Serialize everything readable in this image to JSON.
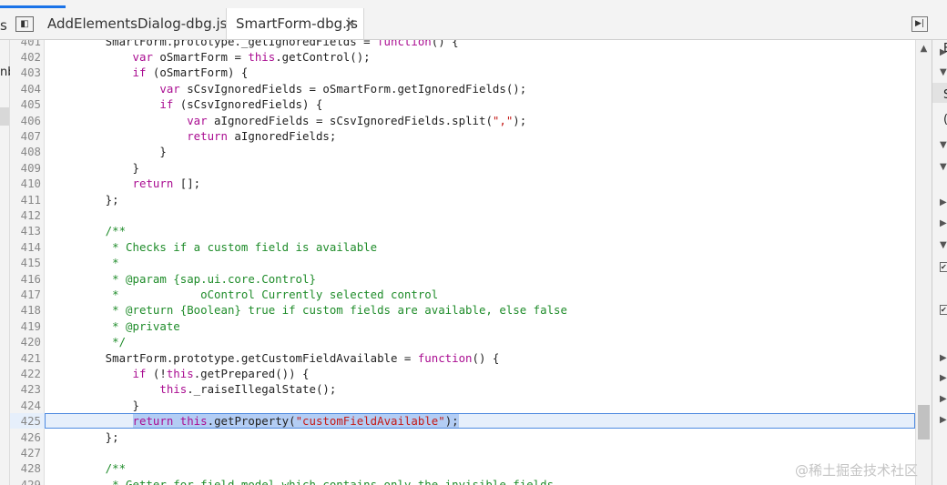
{
  "tabs": {
    "left_fragment": "s",
    "nav_toggle": "◧",
    "tab1": "AddElementsDialog-dbg.js",
    "tab2": "SmartForm-dbg.js",
    "close": "×",
    "right_toggle": "▶|"
  },
  "left_panel": {
    "fragment": "nb"
  },
  "editor": {
    "lines": [
      {
        "n": "401",
        "spans": [
          [
            "",
            "        SmartForm.prototype._getIgnoredFields = "
          ],
          [
            "kw",
            "function"
          ],
          [
            "",
            "() {"
          ]
        ]
      },
      {
        "n": "402",
        "spans": [
          [
            "",
            "            "
          ],
          [
            "kw",
            "var"
          ],
          [
            "",
            " oSmartForm = "
          ],
          [
            "kw",
            "this"
          ],
          [
            "",
            ".getControl();"
          ]
        ]
      },
      {
        "n": "403",
        "spans": [
          [
            "",
            "            "
          ],
          [
            "kw",
            "if"
          ],
          [
            "",
            " (oSmartForm) {"
          ]
        ]
      },
      {
        "n": "404",
        "spans": [
          [
            "",
            "                "
          ],
          [
            "kw",
            "var"
          ],
          [
            "",
            " sCsvIgnoredFields = oSmartForm.getIgnoredFields();"
          ]
        ]
      },
      {
        "n": "405",
        "spans": [
          [
            "",
            "                "
          ],
          [
            "kw",
            "if"
          ],
          [
            "",
            " (sCsvIgnoredFields) {"
          ]
        ]
      },
      {
        "n": "406",
        "spans": [
          [
            "",
            "                    "
          ],
          [
            "kw",
            "var"
          ],
          [
            "",
            " aIgnoredFields = sCsvIgnoredFields.split("
          ],
          [
            "str",
            "\",\""
          ],
          [
            "",
            ");"
          ]
        ]
      },
      {
        "n": "407",
        "spans": [
          [
            "",
            "                    "
          ],
          [
            "kw",
            "return"
          ],
          [
            "",
            " aIgnoredFields;"
          ]
        ]
      },
      {
        "n": "408",
        "spans": [
          [
            "",
            "                }"
          ]
        ]
      },
      {
        "n": "409",
        "spans": [
          [
            "",
            "            }"
          ]
        ]
      },
      {
        "n": "410",
        "spans": [
          [
            "",
            "            "
          ],
          [
            "kw",
            "return"
          ],
          [
            "",
            " [];"
          ]
        ]
      },
      {
        "n": "411",
        "spans": [
          [
            "",
            "        };"
          ]
        ]
      },
      {
        "n": "412",
        "spans": []
      },
      {
        "n": "413",
        "spans": [
          [
            "cmt",
            "        /**"
          ]
        ]
      },
      {
        "n": "414",
        "spans": [
          [
            "cmt",
            "         * Checks if a custom field is available"
          ]
        ]
      },
      {
        "n": "415",
        "spans": [
          [
            "cmt",
            "         *"
          ]
        ]
      },
      {
        "n": "416",
        "spans": [
          [
            "cmt",
            "         * @param {sap.ui.core.Control}"
          ]
        ]
      },
      {
        "n": "417",
        "spans": [
          [
            "cmt",
            "         *            oControl Currently selected control"
          ]
        ]
      },
      {
        "n": "418",
        "spans": [
          [
            "cmt",
            "         * @return {Boolean} true if custom fields are available, else false"
          ]
        ]
      },
      {
        "n": "419",
        "spans": [
          [
            "cmt",
            "         * @private"
          ]
        ]
      },
      {
        "n": "420",
        "spans": [
          [
            "cmt",
            "         */"
          ]
        ]
      },
      {
        "n": "421",
        "spans": [
          [
            "",
            "        SmartForm.prototype.getCustomFieldAvailable = "
          ],
          [
            "kw",
            "function"
          ],
          [
            "",
            "() {"
          ]
        ]
      },
      {
        "n": "422",
        "spans": [
          [
            "",
            "            "
          ],
          [
            "kw",
            "if"
          ],
          [
            "",
            " (!"
          ],
          [
            "kw",
            "this"
          ],
          [
            "",
            ".getPrepared()) {"
          ]
        ]
      },
      {
        "n": "423",
        "spans": [
          [
            "",
            "                "
          ],
          [
            "kw",
            "this"
          ],
          [
            "",
            "._raiseIllegalState();"
          ]
        ]
      },
      {
        "n": "424",
        "spans": [
          [
            "",
            "            }"
          ]
        ]
      },
      {
        "n": "425",
        "hl": true,
        "spans": [
          [
            "",
            "            "
          ],
          [
            "kw sel",
            "return"
          ],
          [
            "sel",
            " "
          ],
          [
            "kw sel",
            "this"
          ],
          [
            "sel",
            ".getProperty("
          ],
          [
            "str sel",
            "\"customFieldAvailable\""
          ],
          [
            "sel",
            ");"
          ]
        ]
      },
      {
        "n": "426",
        "spans": [
          [
            "",
            "        };"
          ]
        ]
      },
      {
        "n": "427",
        "spans": []
      },
      {
        "n": "428",
        "spans": [
          [
            "cmt",
            "        /**"
          ]
        ]
      },
      {
        "n": "429",
        "spans": [
          [
            "cmt",
            "         * Getter for field model which contains only the invisible fields"
          ]
        ]
      }
    ]
  },
  "scroll": {
    "up": "▲"
  },
  "right_panel": {
    "label_e": "E",
    "label_s": "S",
    "label_paren": "(",
    "arrows": [
      "▶",
      "▼",
      "▼",
      "▼",
      "▶",
      "▶",
      "▼",
      "▶",
      "▶",
      "▶",
      "▶"
    ],
    "checks": [
      "✔",
      "✔"
    ]
  },
  "watermark": "@稀土掘金技术社区"
}
